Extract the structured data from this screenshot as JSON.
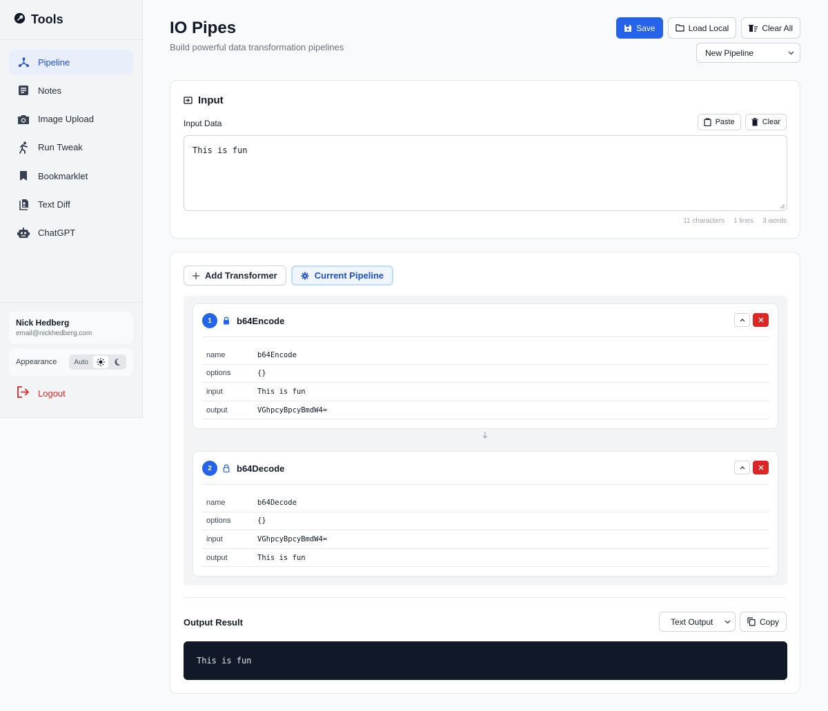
{
  "sidebar": {
    "title": "Tools",
    "items": [
      {
        "label": "Pipeline",
        "icon": "pipeline-icon",
        "active": true
      },
      {
        "label": "Notes",
        "icon": "notes-icon"
      },
      {
        "label": "Image Upload",
        "icon": "camera-icon"
      },
      {
        "label": "Run Tweak",
        "icon": "runner-icon"
      },
      {
        "label": "Bookmarklet",
        "icon": "bookmark-icon"
      },
      {
        "label": "Text Diff",
        "icon": "diff-icon"
      },
      {
        "label": "ChatGPT",
        "icon": "robot-icon"
      }
    ],
    "user": {
      "name": "Nick Hedberg",
      "email": "email@nickhedberg.com"
    },
    "appearance": {
      "label": "Appearance",
      "auto": "Auto"
    },
    "logout": "Logout"
  },
  "header": {
    "title": "IO Pipes",
    "subtitle": "Build powerful data transformation pipelines",
    "save": "Save",
    "load_local": "Load Local",
    "clear_all": "Clear All",
    "pipeline_select": "New Pipeline"
  },
  "input": {
    "title": "Input",
    "label": "Input Data",
    "paste": "Paste",
    "clear": "Clear",
    "value": "This is fun",
    "stats": {
      "characters": "11 characters",
      "lines": "1 lines",
      "words": "3 words"
    }
  },
  "pipeline": {
    "tabs": {
      "add": "Add Transformer",
      "current": "Current Pipeline"
    },
    "steps": [
      {
        "num": "1",
        "name": "b64Encode",
        "rows": [
          {
            "k": "name",
            "v": "b64Encode"
          },
          {
            "k": "options",
            "v": "{}"
          },
          {
            "k": "input",
            "v": "This is fun"
          },
          {
            "k": "output",
            "v": "VGhpcyBpcyBmdW4="
          }
        ]
      },
      {
        "num": "2",
        "name": "b64Decode",
        "rows": [
          {
            "k": "name",
            "v": "b64Decode"
          },
          {
            "k": "options",
            "v": "{}"
          },
          {
            "k": "input",
            "v": "VGhpcyBpcyBmdW4="
          },
          {
            "k": "output",
            "v": "This is fun"
          }
        ]
      }
    ]
  },
  "output": {
    "title": "Output Result",
    "mode": "Text Output",
    "copy": "Copy",
    "value": "This is fun"
  },
  "colors": {
    "accent": "#2563eb",
    "danger": "#dc2626",
    "dark": "#111827"
  }
}
